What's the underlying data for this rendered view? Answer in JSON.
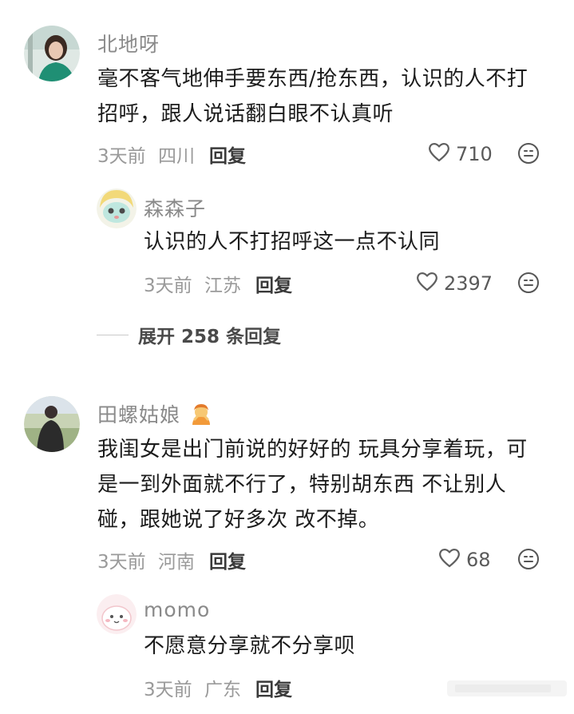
{
  "comments": [
    {
      "username": "北地呀",
      "text": "毫不客气地伸手要东西/抢东西，认识的人不打招呼，跟人说话翻白眼不认真听",
      "time": "3天前",
      "location": "四川",
      "reply_label": "回复",
      "likes": "710",
      "replies": [
        {
          "username": "森森子",
          "text": "认识的人不打招呼这一点不认同",
          "time": "3天前",
          "location": "江苏",
          "reply_label": "回复",
          "likes": "2397"
        }
      ],
      "expand_label": "展开 258 条回复"
    },
    {
      "username": "田螺姑娘",
      "text": "我闺女是出门前说的好好的 玩具分享着玩，可是一到外面就不行了，特别胡东西 不让别人碰，跟她说了好多次 改不掉。",
      "time": "3天前",
      "location": "河南",
      "reply_label": "回复",
      "likes": "68",
      "replies": [
        {
          "username": "momo",
          "text": "不愿意分享就不分享呗",
          "time": "3天前",
          "location": "广东",
          "reply_label": "回复"
        }
      ]
    }
  ],
  "icons": {
    "like": "heart-outline-icon",
    "reaction": "smiley-face-icon",
    "user_badge": "person-gesture-emoji"
  }
}
